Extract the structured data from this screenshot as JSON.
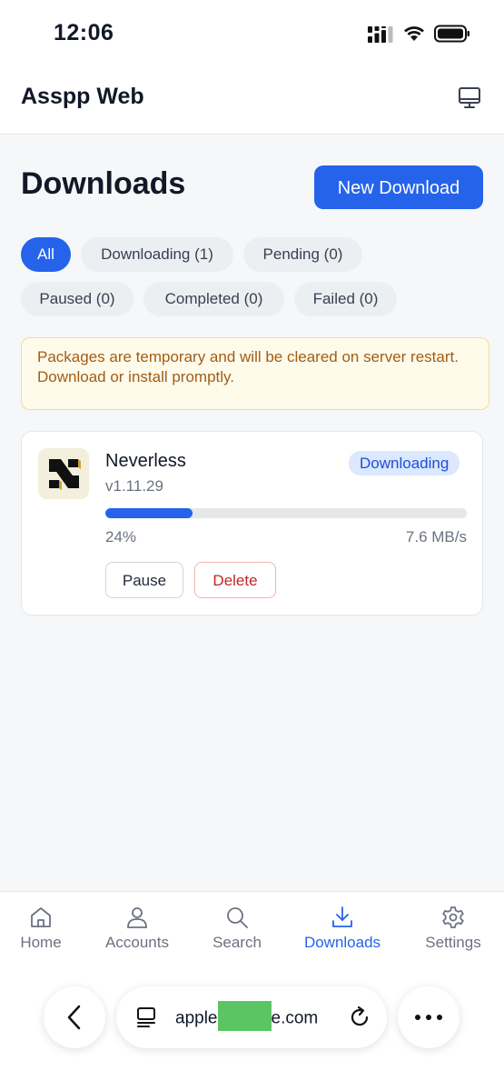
{
  "status_bar": {
    "time": "12:06"
  },
  "header": {
    "title": "Asspp Web",
    "icon": "monitor-icon"
  },
  "main": {
    "title": "Downloads",
    "new_download_label": "New Download",
    "filters": [
      {
        "label": "All",
        "active": true
      },
      {
        "label": "Downloading (1)",
        "active": false
      },
      {
        "label": "Pending (0)",
        "active": false
      },
      {
        "label": "Paused (0)",
        "active": false
      },
      {
        "label": "Completed (0)",
        "active": false
      },
      {
        "label": "Failed (0)",
        "active": false
      }
    ],
    "notice": "Packages are temporary and will be cleared on server restart. Download or install promptly.",
    "downloads": [
      {
        "name": "Neverless",
        "version": "v1.11.29",
        "status": "Downloading",
        "progress_percent": 24,
        "progress_label": "24%",
        "speed": "7.6 MB/s",
        "pause_label": "Pause",
        "delete_label": "Delete"
      }
    ]
  },
  "tab_bar": {
    "items": [
      {
        "label": "Home",
        "icon": "home-icon",
        "active": false
      },
      {
        "label": "Accounts",
        "icon": "user-icon",
        "active": false
      },
      {
        "label": "Search",
        "icon": "search-icon",
        "active": false
      },
      {
        "label": "Downloads",
        "icon": "download-icon",
        "active": true
      },
      {
        "label": "Settings",
        "icon": "gear-icon",
        "active": false
      }
    ]
  },
  "browser": {
    "url_prefix": "apple",
    "url_suffix": "e.com"
  },
  "colors": {
    "accent": "#2563eb",
    "notice_bg": "#fefbeb",
    "notice_text": "#a35c14",
    "danger": "#c02626"
  }
}
